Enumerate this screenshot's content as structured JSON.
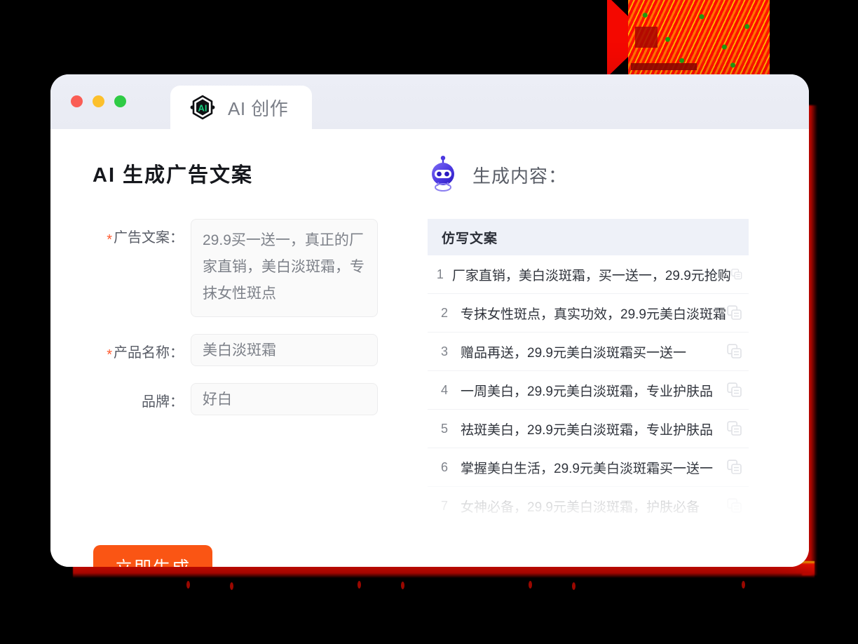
{
  "window": {
    "traffic_lights": [
      {
        "name": "close",
        "color": "#fa5d55"
      },
      {
        "name": "minimize",
        "color": "#fcc02c"
      },
      {
        "name": "maximize",
        "color": "#2fcb45"
      }
    ],
    "tab": {
      "icon": "ai-hexagon-logo-icon",
      "label": "AI 创作"
    }
  },
  "left": {
    "page_title": "AI 生成广告文案",
    "fields": [
      {
        "required": true,
        "star": "*",
        "label": "广告文案：",
        "value": "29.9买一送一，真正的厂家直销，美白淡斑霜，专抹女性斑点",
        "type": "textarea"
      },
      {
        "required": true,
        "star": "*",
        "label": "产品名称：",
        "value": "美白淡斑霜",
        "type": "input"
      },
      {
        "required": false,
        "star": "",
        "label": "品牌：",
        "value": "好白",
        "type": "input"
      }
    ],
    "generate_button": "立即生成"
  },
  "right": {
    "icon": "robot-icon",
    "title": "生成内容：",
    "table": {
      "column_header": "仿写文案",
      "copy_icon": "copy-icon",
      "rows": [
        {
          "index": "1",
          "text": "厂家直销，美白淡斑霜，买一送一，29.9元抢购"
        },
        {
          "index": "2",
          "text": "专抹女性斑点，真实功效，29.9元美白淡斑霜"
        },
        {
          "index": "3",
          "text": "赠品再送，29.9元美白淡斑霜买一送一"
        },
        {
          "index": "4",
          "text": "一周美白，29.9元美白淡斑霜，专业护肤品"
        },
        {
          "index": "5",
          "text": "祛斑美白，29.9元美白淡斑霜，专业护肤品"
        },
        {
          "index": "6",
          "text": "掌握美白生活，29.9元美白淡斑霜买一送一"
        },
        {
          "index": "7",
          "text": "女神必备，29.9元美白淡斑霜，护肤必备"
        }
      ]
    }
  },
  "colors": {
    "accent_orange": "#fa5514",
    "required_star": "#ff5b30",
    "titlebar": "#eceef6",
    "table_header_bg": "#eef1f8",
    "logo_green": "#17d07e",
    "robot_blue": "#3b2fd6",
    "background": "#000000",
    "decor_red": "#e81f00"
  }
}
